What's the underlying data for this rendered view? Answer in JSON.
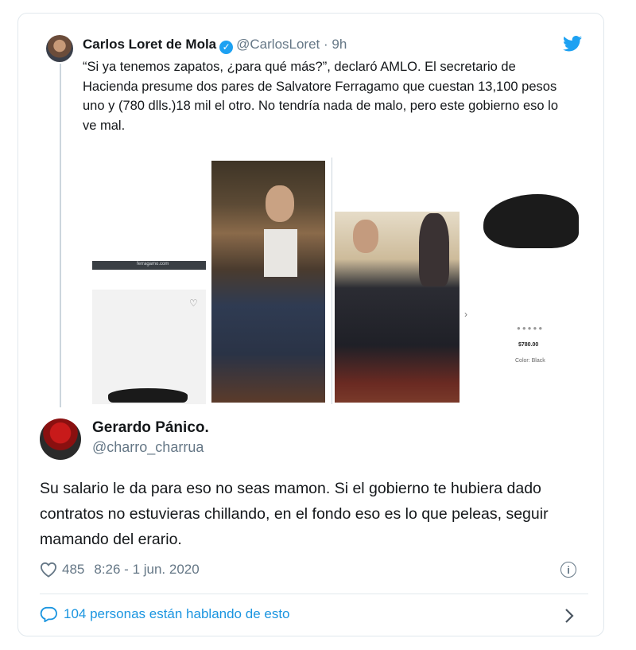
{
  "quoted_tweet": {
    "author_name": "Carlos Loret de Mola",
    "verified_icon": "verified-badge-icon",
    "handle": "@CarlosLoret",
    "separator": "·",
    "time": "9h",
    "text": "“Si ya tenemos zapatos, ¿para qué más?”, declaró AMLO. El secretario de Hacienda presume dos pares de Salvatore Ferragamo que cuestan 13,100 pesos uno y (780 dlls.)18 mil el otro. No tendría nada de malo, pero este gobierno eso lo ve mal.",
    "media": {
      "site_label": "ferragamo.com",
      "price": "$780.00",
      "color_label": "Color: Black"
    }
  },
  "tweet": {
    "author_name": "Gerardo Pánico.",
    "handle": "@charro_charrua",
    "text": "Su salario le da para eso no seas mamon. Si el gobierno te hubiera dado contratos no estuvieras chillando, en el fondo eso es lo que peleas, seguir mamando del erario.",
    "likes": "485",
    "timestamp": "8:26 - 1 jun. 2020",
    "conversation": "104 personas están hablando de esto"
  },
  "colors": {
    "accent": "#1da1f2",
    "link": "#1b95e0",
    "muted": "#657786",
    "border": "#e1e8ed"
  },
  "icons": [
    "twitter-bird-icon",
    "heart-icon",
    "info-icon",
    "speech-bubble-icon",
    "chevron-right-icon"
  ]
}
